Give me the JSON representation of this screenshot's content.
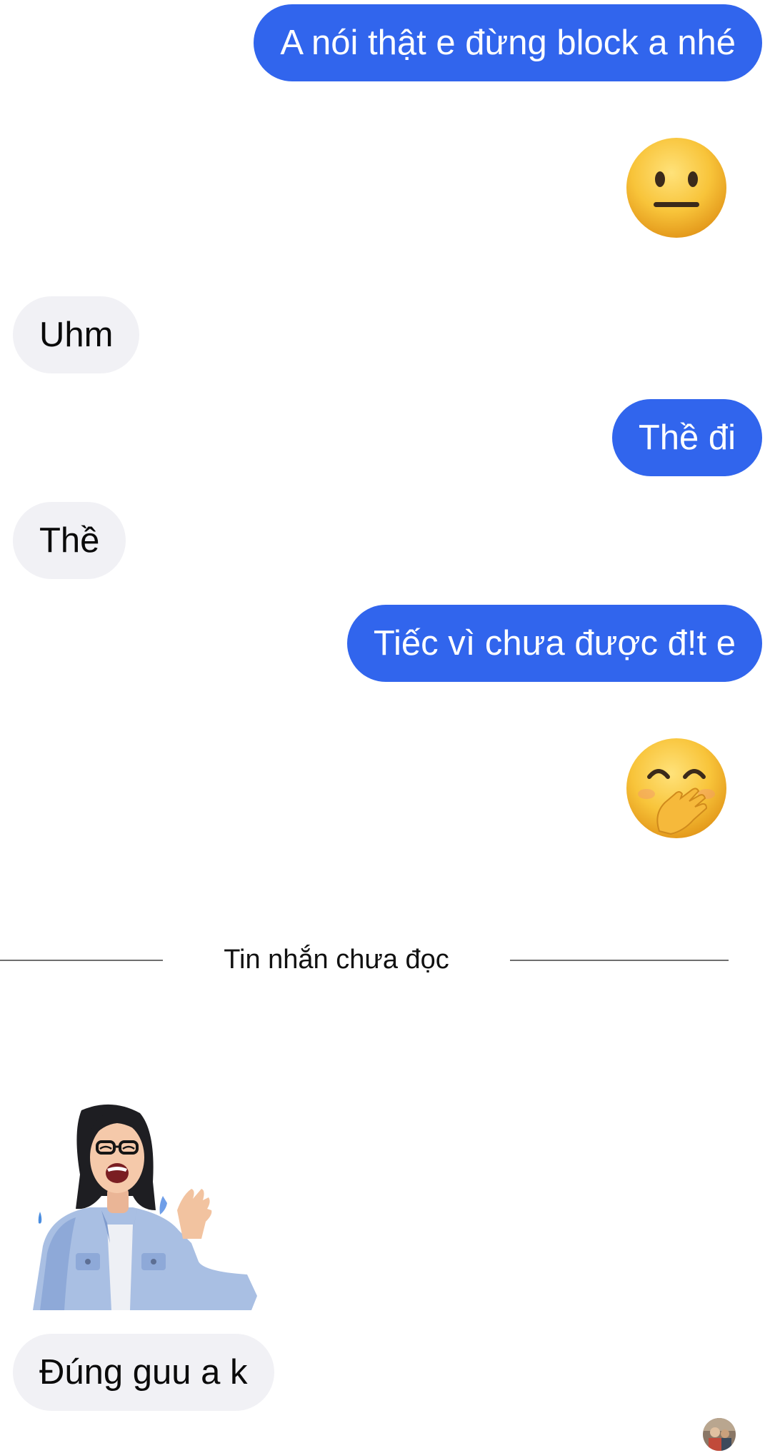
{
  "conversation": {
    "messages": [
      {
        "sender": "me",
        "type": "text",
        "text": "A nói thật e đừng block a nhé"
      },
      {
        "sender": "me",
        "type": "emoji",
        "emoji": "neutral-face"
      },
      {
        "sender": "other",
        "type": "text",
        "text": "Uhm"
      },
      {
        "sender": "me",
        "type": "text",
        "text": "Thề đi"
      },
      {
        "sender": "other",
        "type": "text",
        "text": "Thề"
      },
      {
        "sender": "me",
        "type": "text",
        "text": "Tiếc vì chưa được đ!t e"
      },
      {
        "sender": "me",
        "type": "emoji",
        "emoji": "face-with-hand-over-mouth"
      },
      {
        "sender": "other",
        "type": "sticker",
        "sticker": "avatar-laughing-sticker"
      },
      {
        "sender": "other",
        "type": "text",
        "text": "Đúng guu a k"
      }
    ],
    "unread_divider": "Tin nhắn chưa đọc"
  },
  "colors": {
    "sent_bubble": "#3165ed",
    "received_bubble": "#f1f1f5",
    "divider_line": "#6e6e6e"
  },
  "icons": {
    "read_receipt": "read-receipt-avatar"
  }
}
